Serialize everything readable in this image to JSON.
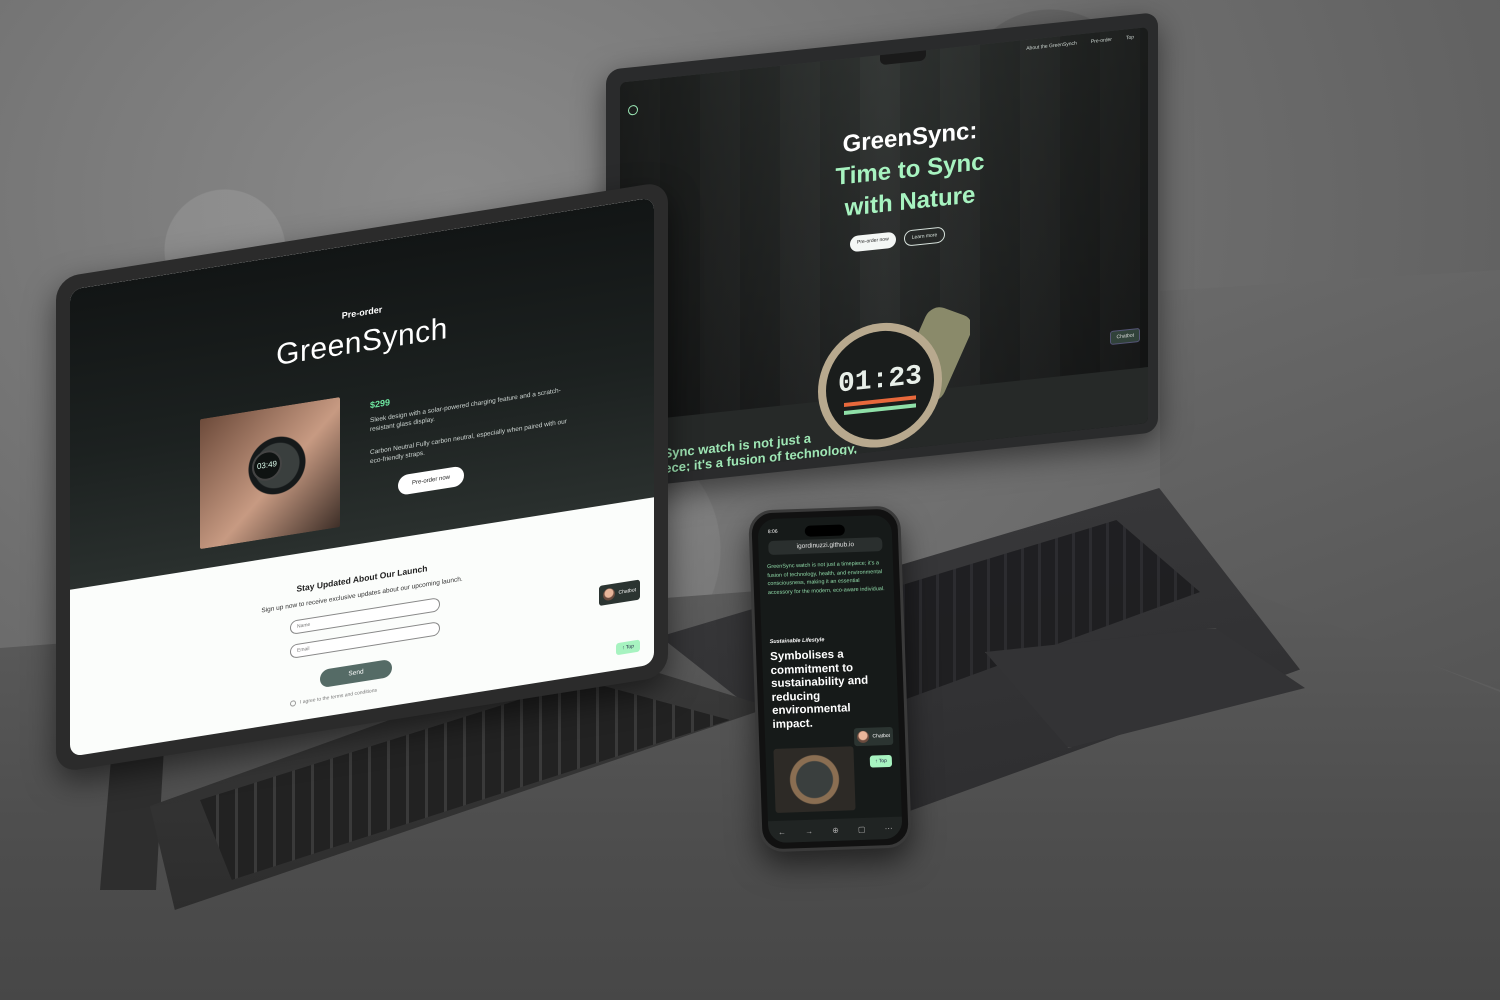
{
  "laptop": {
    "nav": [
      "About the GreenSynch",
      "Pre-order",
      "Top"
    ],
    "title_line1": "GreenSync:",
    "title_line2": "Time to Sync",
    "title_line3": "with Nature",
    "buttons": {
      "primary": "Pre-order now",
      "secondary": "Learn more"
    },
    "watch_time": "01:23",
    "chat_label": "Chatbot",
    "body_text": "GreenSync watch is not just a timepiece; it's a fusion of technology, health, and environmental conscious... essential accessory... aware individual."
  },
  "tablet": {
    "kicker": "Pre-order",
    "product_name": "GreenSynch",
    "price": "$299",
    "desc1": "Sleek design with a solar-powered charging feature and a scratch-resistant glass display.",
    "desc2": "Carbon Neutral Fully carbon neutral, especially when paired with our eco-friendly straps.",
    "preorder_button": "Pre-order now",
    "watch_face": "03:49",
    "newsletter_title": "Stay Updated About Our Launch",
    "newsletter_text": "Sign up now to receive exclusive updates about our upcoming launch.",
    "name_placeholder": "Name",
    "email_placeholder": "Email",
    "send_button": "Send",
    "agree_text": "I agree to the terms and conditions",
    "chat_label": "Chatbot",
    "top_button": "↑ Top"
  },
  "phone": {
    "time": "8:06",
    "url": "igordinuzzi.github.io",
    "body_text": "GreenSync watch is not just a timepiece; it's a fusion of technology, health, and environmental consciousness, making it an essential accessory for the modern, eco-aware individual.",
    "kicker": "Sustainable Lifestyle",
    "headline": "Symbolises a commitment to sustainability and reducing environmental impact.",
    "chat_label": "Chatbot",
    "top_button": "↑ Top"
  },
  "colors": {
    "accent_green": "#a7f3c0",
    "price_green": "#6ee7a0",
    "dark_bg": "#1c2120",
    "send_button": "#556b66"
  }
}
